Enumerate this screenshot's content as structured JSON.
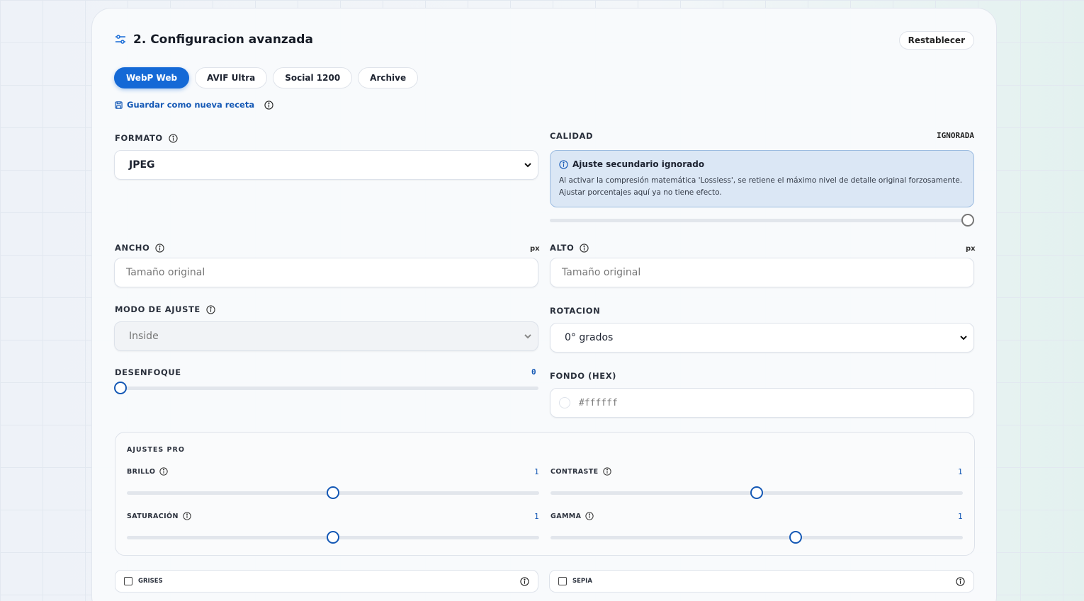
{
  "header": {
    "title": "2. Configuracion avanzada",
    "reset_label": "Restablecer"
  },
  "presets": [
    {
      "label": "WebP Web",
      "active": true
    },
    {
      "label": "AVIF Ultra",
      "active": false
    },
    {
      "label": "Social 1200",
      "active": false
    },
    {
      "label": "Archive",
      "active": false
    }
  ],
  "save_recipe_label": "Guardar como nueva receta",
  "formato": {
    "label": "FORMATO",
    "value": "JPEG"
  },
  "calidad": {
    "label": "CALIDAD",
    "status": "IGNORADA",
    "notice_title": "Ajuste secundario ignorado",
    "notice_text": "Al activar la compresión matemática 'Lossless', se retiene el máximo nivel de detalle original forzosamente. Ajustar porcentajes aquí ya no tiene efecto.",
    "level": 1.0
  },
  "ancho": {
    "label": "ANCHO",
    "unit": "px",
    "placeholder": "Tamaño original"
  },
  "alto": {
    "label": "ALTO",
    "unit": "px",
    "placeholder": "Tamaño original"
  },
  "modo_ajuste": {
    "label": "MODO DE AJUSTE",
    "value": "Inside"
  },
  "rotacion": {
    "label": "ROTACION",
    "value": "0° grados"
  },
  "desenfoque": {
    "label": "DESENFOQUE",
    "value": "0",
    "level": 0.0
  },
  "fondo": {
    "label": "FONDO (HEX)",
    "placeholder": "#ffffff"
  },
  "ajustes_pro": {
    "title": "AJUSTES PRO",
    "brillo": {
      "label": "BRILLO",
      "value": "1",
      "level": 0.5
    },
    "contraste": {
      "label": "CONTRASTE",
      "value": "1",
      "level": 0.5
    },
    "saturacion": {
      "label": "SATURACIÓN",
      "value": "1",
      "level": 0.5
    },
    "gamma": {
      "label": "GAMMA",
      "value": "1",
      "level": 0.597
    }
  },
  "toggles": {
    "grises": {
      "label": "GRISES",
      "checked": false
    },
    "sepia": {
      "label": "SEPIA",
      "checked": false
    }
  },
  "colors": {
    "accent": "#1469d6",
    "link": "#1458b5",
    "notice_bg": "#dbe7f5"
  }
}
